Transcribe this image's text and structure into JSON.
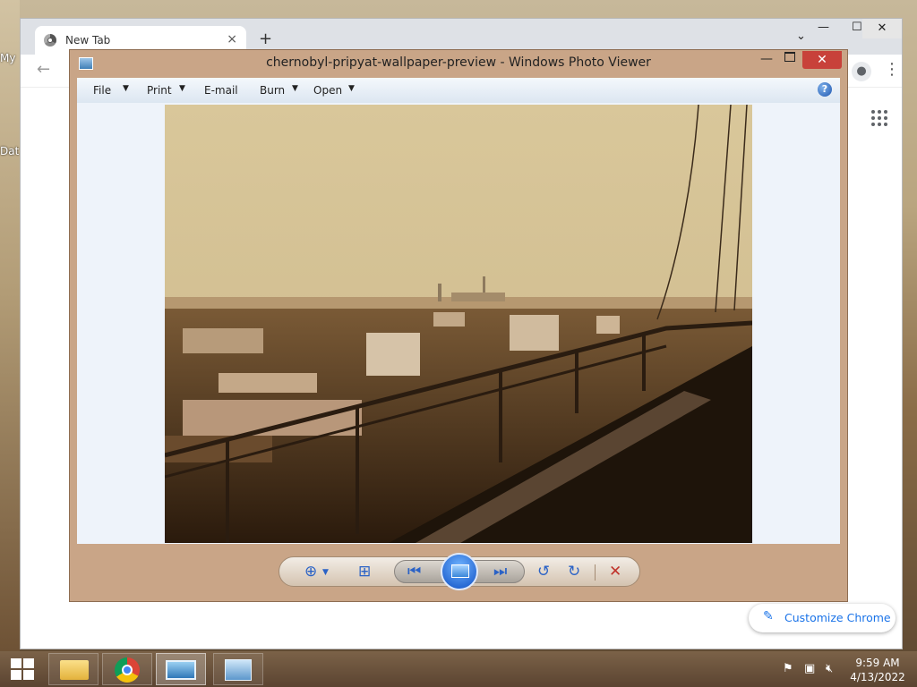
{
  "desktop": {
    "icon_labels": [
      "My",
      "Dat"
    ]
  },
  "browser": {
    "tab_title": "New Tab",
    "tab_close": "×",
    "new_tab": "+",
    "tab_menu": "⌄",
    "minimize": "—",
    "maximize": "☐",
    "close": "✕",
    "back": "←",
    "menu": "⋮",
    "customize_label": "Customize Chrome"
  },
  "photo_viewer": {
    "title": "chernobyl-pripyat-wallpaper-preview - Windows Photo Viewer",
    "menu": [
      {
        "label": "File",
        "dropdown": true
      },
      {
        "label": "Print",
        "dropdown": true
      },
      {
        "label": "E-mail",
        "dropdown": false
      },
      {
        "label": "Burn",
        "dropdown": true
      },
      {
        "label": "Open",
        "dropdown": true
      }
    ],
    "help": "?",
    "minimize": "—",
    "close": "✕",
    "controls": {
      "zoom": "zoom-icon",
      "actual_size": "fit-window-icon",
      "previous": "previous-icon",
      "slideshow": "slideshow-icon",
      "next": "next-icon",
      "rotate_ccw": "rotate-counterclockwise-icon",
      "rotate_cw": "rotate-clockwise-icon",
      "delete": "delete-icon"
    }
  },
  "taskbar": {
    "clock_time": "9:59 AM",
    "clock_date": "4/13/2022"
  },
  "colors": {
    "viewer_frame": "#c9a587",
    "close_red": "#c8413a",
    "accent_blue": "#1a73e8"
  }
}
